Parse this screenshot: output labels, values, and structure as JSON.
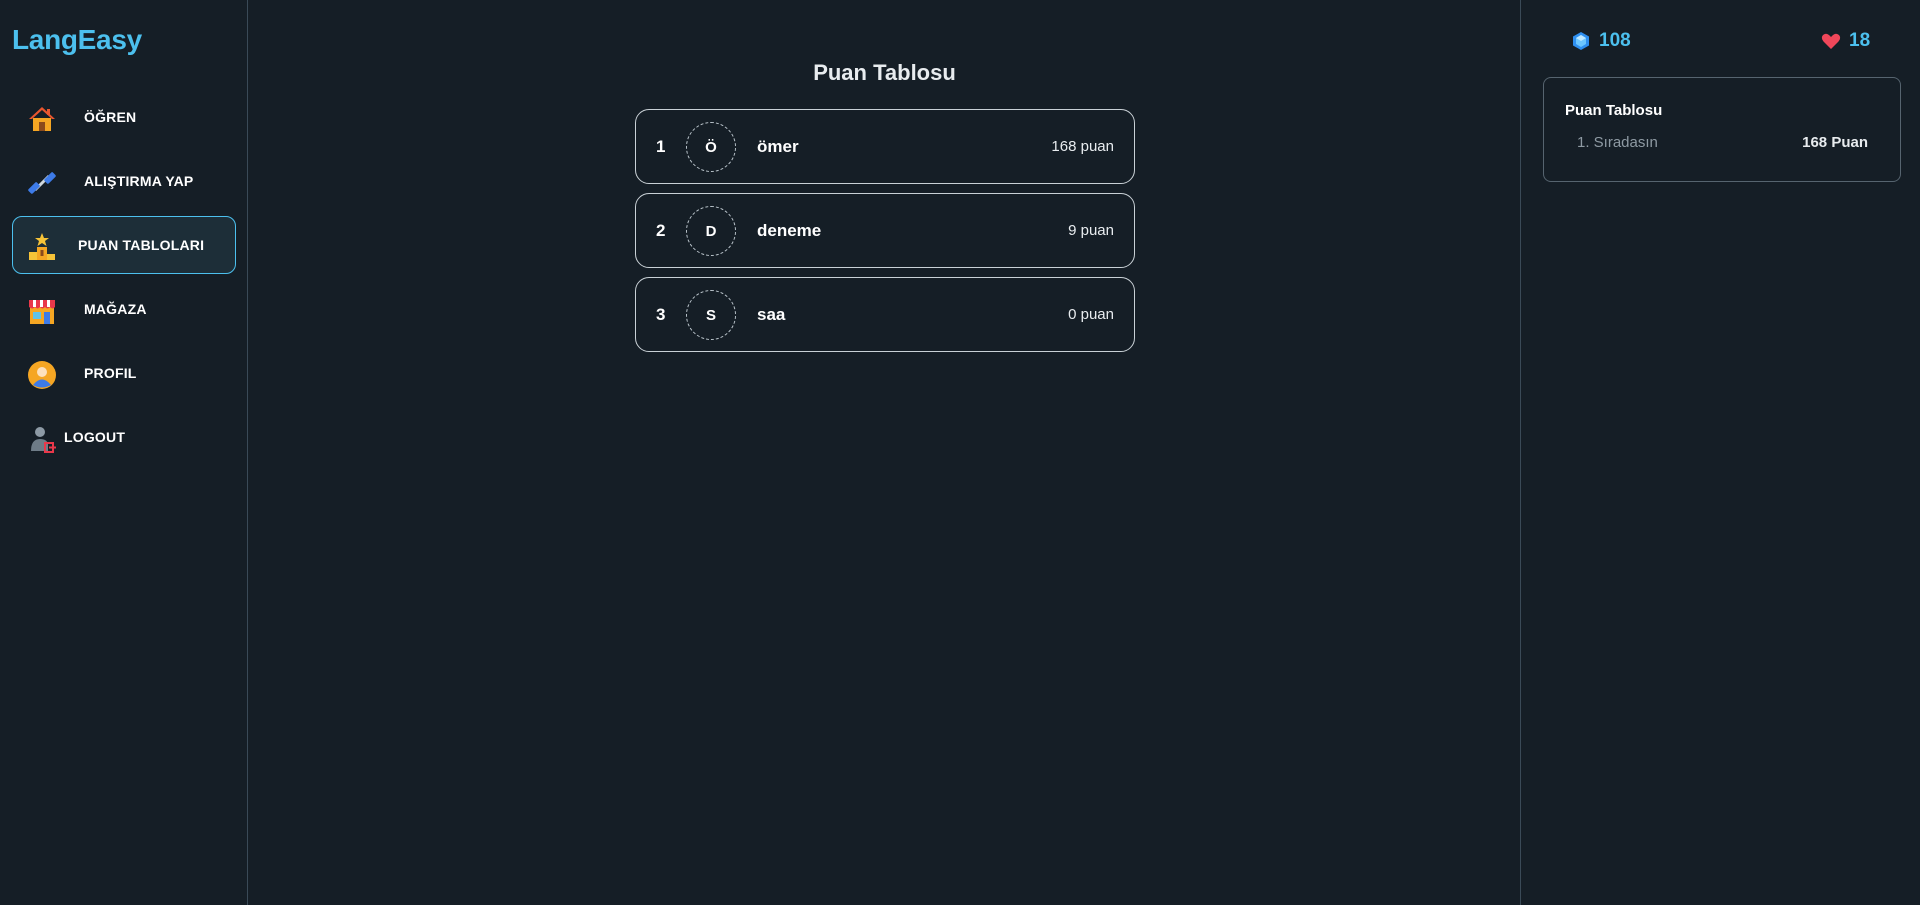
{
  "app": {
    "logo": "LangEasy"
  },
  "sidebar": {
    "items": [
      {
        "label": "ÖĞREN",
        "icon": "house-icon",
        "active": false
      },
      {
        "label": "ALIŞTIRMA YAP",
        "icon": "dumbbell-icon",
        "active": false
      },
      {
        "label": "PUAN TABLOLARI",
        "icon": "podium-icon",
        "active": true
      },
      {
        "label": "MAĞAZA",
        "icon": "shop-icon",
        "active": false
      },
      {
        "label": "PROFIL",
        "icon": "profile-icon",
        "active": false
      },
      {
        "label": "LOGOUT",
        "icon": "logout-icon",
        "active": false
      }
    ]
  },
  "main": {
    "title": "Puan Tablosu",
    "leaderboard": [
      {
        "rank": "1",
        "initial": "Ö",
        "name": "ömer",
        "score": "168 puan"
      },
      {
        "rank": "2",
        "initial": "D",
        "name": "deneme",
        "score": "9 puan"
      },
      {
        "rank": "3",
        "initial": "S",
        "name": "saa",
        "score": "0 puan"
      }
    ]
  },
  "stats": {
    "gems": "108",
    "hearts": "18"
  },
  "summary_card": {
    "title": "Puan Tablosu",
    "rank_text": "1. Sıradasın",
    "points_text": "168 Puan"
  },
  "colors": {
    "background": "#151e26",
    "accent": "#4cc0ee",
    "active_bg": "#1d2e38",
    "heart": "#f0475a",
    "gem": "#2e8ff0"
  }
}
